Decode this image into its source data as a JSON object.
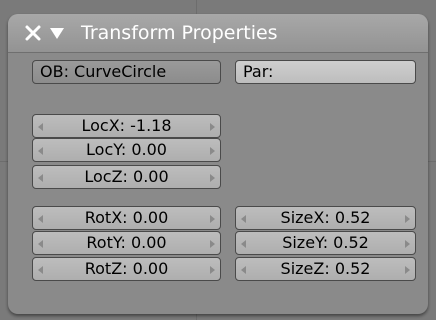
{
  "panel": {
    "title": "Transform Properties"
  },
  "object": {
    "ob_field": "OB: CurveCircle",
    "par_field": "Par:"
  },
  "location": {
    "x": "LocX: -1.18",
    "y": "LocY: 0.00",
    "z": "LocZ: 0.00"
  },
  "rotation": {
    "x": "RotX: 0.00",
    "y": "RotY: 0.00",
    "z": "RotZ: 0.00"
  },
  "size": {
    "x": "SizeX: 0.52",
    "y": "SizeY: 0.52",
    "z": "SizeZ: 0.52"
  },
  "icons": {
    "close": "close-icon",
    "collapse": "collapse-triangle-icon",
    "decrement": "left-arrow-icon",
    "increment": "right-arrow-icon"
  }
}
